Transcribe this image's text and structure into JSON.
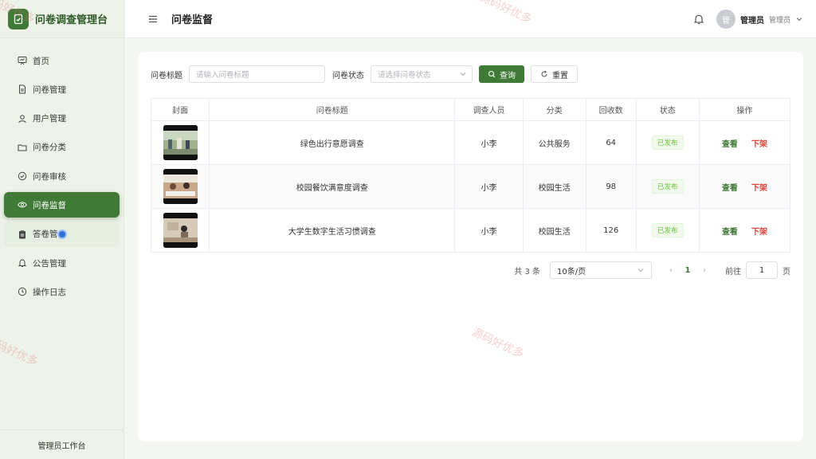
{
  "app": {
    "title": "问卷调查管理台",
    "footer": "管理员工作台"
  },
  "sidebar": {
    "items": [
      {
        "label": "首页",
        "icon": "dashboard-icon"
      },
      {
        "label": "问卷管理",
        "icon": "document-icon"
      },
      {
        "label": "用户管理",
        "icon": "user-icon"
      },
      {
        "label": "问卷分类",
        "icon": "folder-icon"
      },
      {
        "label": "问卷审核",
        "icon": "check-circle-icon"
      },
      {
        "label": "问卷监督",
        "icon": "eye-icon",
        "active": true
      },
      {
        "label": "答卷管",
        "icon": "clipboard-icon"
      },
      {
        "label": "公告管理",
        "icon": "bell-icon"
      },
      {
        "label": "操作日志",
        "icon": "clock-icon"
      }
    ]
  },
  "header": {
    "page_title": "问卷监督",
    "avatar_text": "管",
    "user_name": "管理员",
    "user_role": "管理员"
  },
  "filters": {
    "title_label": "问卷标题",
    "title_placeholder": "请输入问卷标题",
    "status_label": "问卷状态",
    "status_placeholder": "请选择问卷状态",
    "search_label": "查询",
    "reset_label": "重置"
  },
  "table": {
    "columns": [
      "封面",
      "问卷标题",
      "调查人员",
      "分类",
      "回收数",
      "状态",
      "操作"
    ],
    "rows": [
      {
        "title": "绿色出行意愿调查",
        "surveyor": "小李",
        "category": "公共服务",
        "count": "64",
        "status": "已发布",
        "view": "查看",
        "offline": "下架"
      },
      {
        "title": "校园餐饮满意度调查",
        "surveyor": "小李",
        "category": "校园生活",
        "count": "98",
        "status": "已发布",
        "view": "查看",
        "offline": "下架"
      },
      {
        "title": "大学生数字生活习惯调查",
        "surveyor": "小李",
        "category": "校园生活",
        "count": "126",
        "status": "已发布",
        "view": "查看",
        "offline": "下架"
      }
    ]
  },
  "pagination": {
    "total": "共 3 条",
    "page_size": "10条/页",
    "current_page": "1",
    "goto_label": "前往",
    "goto_value": "1",
    "page_suffix": "页"
  },
  "watermark": "源码好优多",
  "colors": {
    "primary": "#3f7a36",
    "danger": "#e0443a",
    "success": "#67c23a"
  }
}
